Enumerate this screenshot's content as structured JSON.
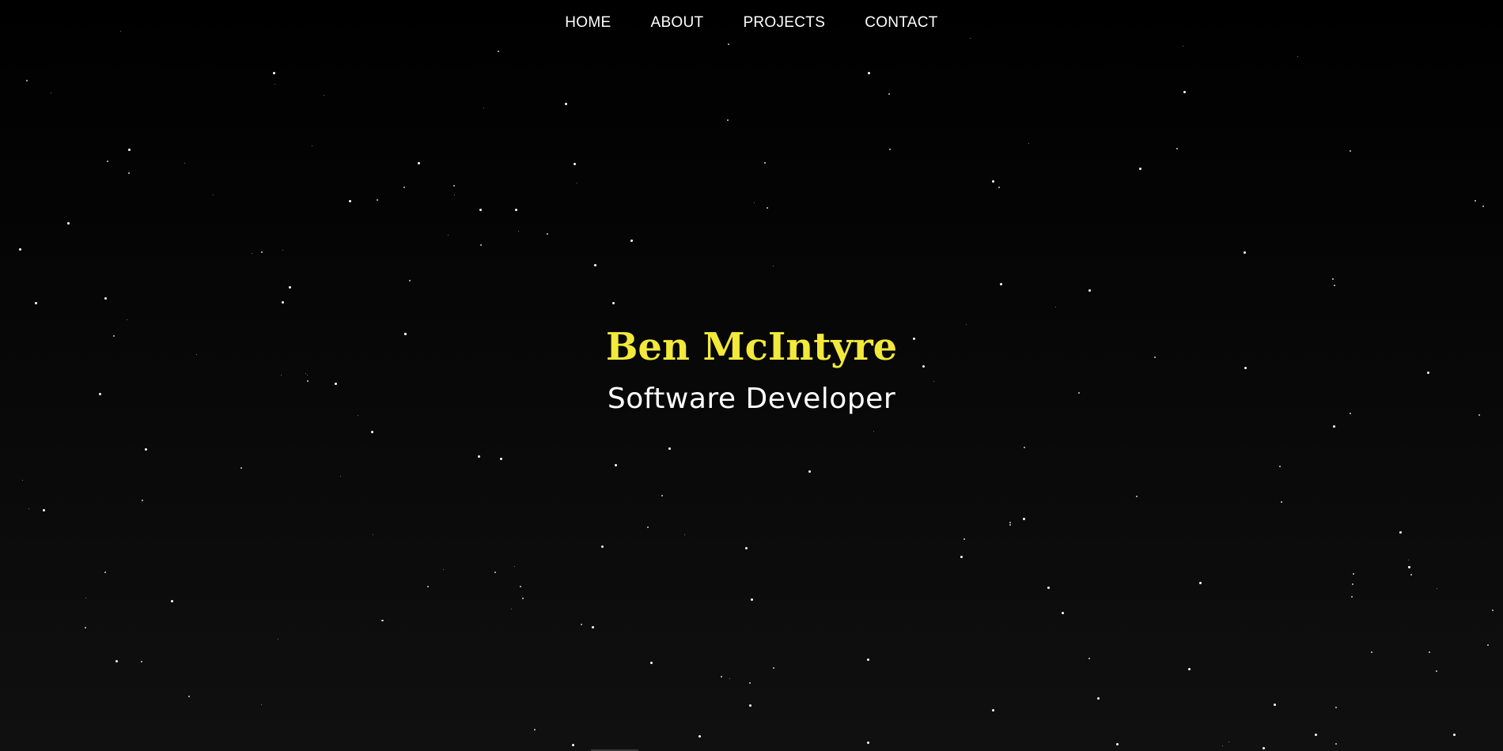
{
  "nav": {
    "items": [
      {
        "label": "HOME",
        "name": "nav-home"
      },
      {
        "label": "ABOUT",
        "name": "nav-about"
      },
      {
        "label": "PROJECTS",
        "name": "nav-projects"
      },
      {
        "label": "CONTACT",
        "name": "nav-contact"
      }
    ]
  },
  "hero": {
    "name": "Ben McIntyre",
    "role": "Software Developer"
  },
  "colors": {
    "accent": "#f2e93a",
    "text": "#ffffff",
    "background": "#000000"
  }
}
